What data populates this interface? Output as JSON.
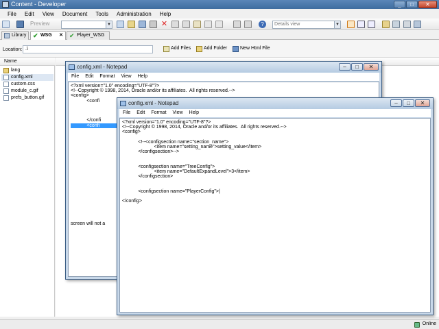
{
  "window": {
    "title": "Content - Developer"
  },
  "menu": [
    "File",
    "Edit",
    "View",
    "Document",
    "Tools",
    "Administration",
    "Help"
  ],
  "toolbar": {
    "preview_label": "Preview",
    "view_select": "Details view"
  },
  "tabs": [
    {
      "label": "Library"
    },
    {
      "label": "WSG"
    },
    {
      "label": "Player_WSG"
    }
  ],
  "location": {
    "label": "Location:",
    "value": ".\\"
  },
  "actions": {
    "add_files": "Add Files",
    "add_folder": "Add Folder",
    "new_html": "New Html File"
  },
  "files": {
    "header": "Name",
    "items": [
      "lang",
      "config.xml",
      "custom.css",
      "module_c.gif",
      "prefs_button.gif"
    ]
  },
  "status": {
    "text": "Online"
  },
  "notepad_back": {
    "title": "config.xml - Notepad",
    "menu": [
      "File",
      "Edit",
      "Format",
      "View",
      "Help"
    ],
    "lines": [
      "<?xml version=\"1.0\" encoding=\"UTF-8\"?>",
      "<!--Copyright © 1998, 2014, Oracle and/or its affiliates.  All rights reserved.-->",
      "<config>",
      "            <confi",
      "",
      "",
      "",
      "            </confi",
      "            <confi",
      "",
      "",
      "",
      "",
      "",
      "",
      "",
      "",
      "",
      "",
      "",
      "",
      "",
      "",
      "",
      "",
      "",
      "",
      "",
      "screen will not a"
    ]
  },
  "notepad_front": {
    "title": "config.xml - Notepad",
    "menu": [
      "File",
      "Edit",
      "Format",
      "View",
      "Help"
    ],
    "lines": [
      "<?xml version=\"1.0\" encoding=\"UTF-8\"?>",
      "<!--Copyright © 1998, 2014, Oracle and/or its affiliates.  All rights reserved.-->",
      "<config>",
      "",
      "            <!--<configsection name=\"section_name\">",
      "                        <item name=\"setting_name\">setting_value</item>",
      "            </configsection>-->",
      "",
      "",
      "            <configsection name=\"TreeConfig\">",
      "                        <item name=\"DefaultExpandLevel\">3</item>",
      "            </configsection>",
      "",
      "",
      "            <configsection name=\"PlayerConfig\">|",
      "",
      "</config>"
    ]
  }
}
